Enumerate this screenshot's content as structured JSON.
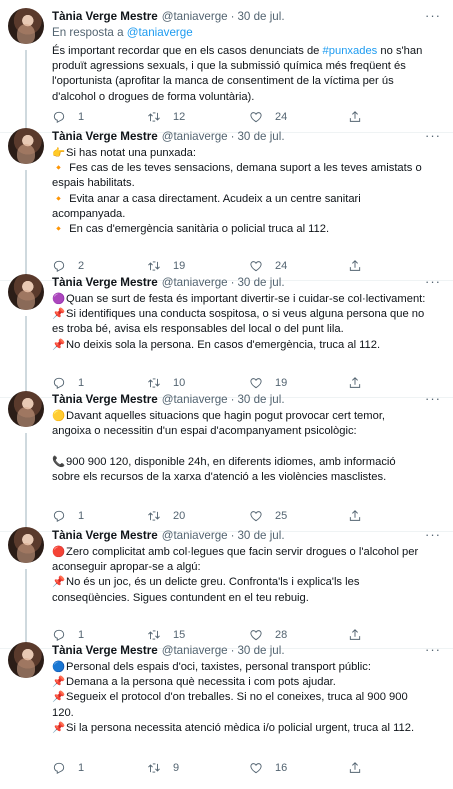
{
  "tweets": [
    {
      "name": "Tània Verge Mestre",
      "handle": "@taniaverge",
      "dot": "·",
      "date": "30 de jul.",
      "reply_prefix": "En resposta a ",
      "reply_handle": "@taniaverge",
      "lines": [
        {
          "pre": "És important recordar que en els casos denunciats de ",
          "tag": "#punxades",
          "post": " no s'han"
        },
        {
          "text": "produït agressions sexuals, i que la submissió química més freqüent és"
        },
        {
          "text": "l'oportunista (aprofitar la manca de consentiment de la víctima per ús"
        },
        {
          "text": "d'alcohol o drogues de forma voluntària)."
        }
      ],
      "replies": "1",
      "retweets": "12",
      "likes": "24"
    },
    {
      "name": "Tània Verge Mestre",
      "handle": "@taniaverge",
      "dot": "·",
      "date": "30 de jul.",
      "lines": [
        {
          "emoji": "👉",
          "text": "Si has notat una punxada:"
        },
        {
          "emoji": "🔸",
          "text": " Fes cas de les teves sensacions, demana suport a les teves amistats o"
        },
        {
          "text": "espais habilitats."
        },
        {
          "emoji": "🔸",
          "text": " Evita anar a casa directament. Acudeix a un centre sanitari"
        },
        {
          "text": "acompanyada."
        },
        {
          "emoji": "🔸",
          "text": " En cas d'emergència sanitària o policial truca al 112."
        }
      ],
      "replies": "2",
      "retweets": "19",
      "likes": "24"
    },
    {
      "name": "Tània Verge Mestre",
      "handle": "@taniaverge",
      "dot": "·",
      "date": "30 de jul.",
      "lines": [
        {
          "emoji": "🟣",
          "text": "Quan se surt de festa és important divertir-se i cuidar-se col·lectivament:"
        },
        {
          "emoji": "📌",
          "text": "Si identifiques una conducta sospitosa, o si veus alguna persona que no"
        },
        {
          "text": "es troba bé, avisa els responsables del local o del punt lila."
        },
        {
          "emoji": "📌",
          "text": "No deixis sola la persona. En casos d'emergència, truca al 112."
        }
      ],
      "replies": "1",
      "retweets": "10",
      "likes": "19"
    },
    {
      "name": "Tània Verge Mestre",
      "handle": "@taniaverge",
      "dot": "·",
      "date": "30 de jul.",
      "lines": [
        {
          "emoji": "🟡",
          "text": "Davant aquelles situacions que hagin pogut provocar cert temor,"
        },
        {
          "text": "angoixa o necessitin d'un espai d'acompanyament psicològic:"
        },
        {
          "gap": true
        },
        {
          "emoji": "📞",
          "text": "900 900 120, disponible 24h, en diferents idiomes, amb informació"
        },
        {
          "text": "sobre els recursos de la xarxa d'atenció a les violències masclistes."
        }
      ],
      "replies": "1",
      "retweets": "20",
      "likes": "25"
    },
    {
      "name": "Tània Verge Mestre",
      "handle": "@taniaverge",
      "dot": "·",
      "date": "30 de jul.",
      "lines": [
        {
          "emoji": "🔴",
          "text": "Zero complicitat amb col·legues que facin servir drogues o l'alcohol per"
        },
        {
          "text": "aconseguir apropar-se a algú:"
        },
        {
          "emoji": "📌",
          "text": "No és un joc, és un delicte greu. Confronta'ls i explica'ls les"
        },
        {
          "text": "conseqüències. Sigues contundent en el teu rebuig."
        }
      ],
      "replies": "1",
      "retweets": "15",
      "likes": "28"
    },
    {
      "name": "Tània Verge Mestre",
      "handle": "@taniaverge",
      "dot": "·",
      "date": "30 de jul.",
      "lines": [
        {
          "emoji": "🔵",
          "text": "Personal dels espais d'oci, taxistes, personal transport públic:"
        },
        {
          "emoji": "📌",
          "text": "Demana a la persona què necessita i com pots ajudar."
        },
        {
          "emoji": "📌",
          "text": "Segueix el protocol d'on treballes. Si no el coneixes, truca al 900 900"
        },
        {
          "text": "120."
        },
        {
          "emoji": "📌",
          "text": "Si la persona necessita atenció mèdica i/o policial urgent, truca al 112."
        }
      ],
      "replies": "1",
      "retweets": "9",
      "likes": "16"
    }
  ],
  "icons": {
    "more": "more-horizontal-icon",
    "reply": "reply-icon",
    "retweet": "retweet-icon",
    "like": "heart-icon",
    "share": "share-icon"
  },
  "colors": {
    "link": "#1d9bf0",
    "secondary_text": "#536471",
    "thread_line": "#cfd9de"
  }
}
